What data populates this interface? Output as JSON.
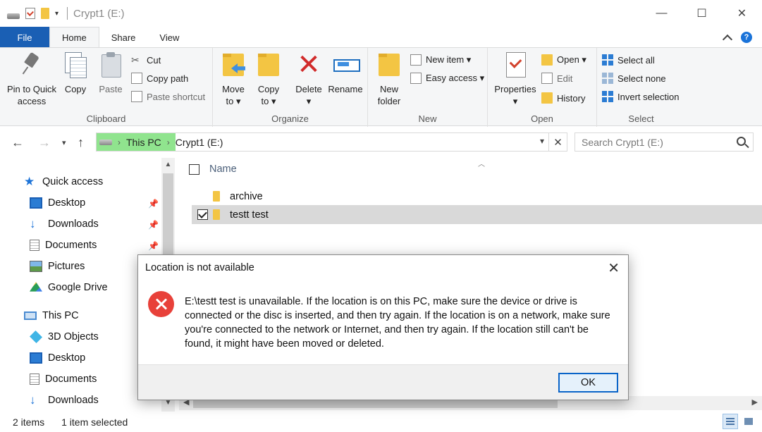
{
  "window": {
    "title": "Crypt1 (E:)",
    "controls": {
      "minimize": "—",
      "maximize": "☐",
      "close": "✕"
    }
  },
  "ribbon_tabs": [
    "File",
    "Home",
    "Share",
    "View"
  ],
  "ribbon": {
    "clipboard": {
      "pin_label_1": "Pin to Quick",
      "pin_label_2": "access",
      "copy": "Copy",
      "paste": "Paste",
      "cut": "Cut",
      "copy_path": "Copy path",
      "paste_shortcut": "Paste shortcut",
      "group": "Clipboard"
    },
    "organize": {
      "move_to_1": "Move",
      "move_to_2": "to ▾",
      "copy_to_1": "Copy",
      "copy_to_2": "to ▾",
      "delete_1": "Delete",
      "delete_2": "▾",
      "rename": "Rename",
      "group": "Organize"
    },
    "new": {
      "new_folder_1": "New",
      "new_folder_2": "folder",
      "new_item": "New item ▾",
      "easy_access": "Easy access ▾",
      "group": "New"
    },
    "open": {
      "properties_1": "Properties",
      "properties_2": "▾",
      "open": "Open ▾",
      "edit": "Edit",
      "history": "History",
      "group": "Open"
    },
    "select": {
      "select_all": "Select all",
      "select_none": "Select none",
      "invert_selection": "Invert selection",
      "group": "Select"
    }
  },
  "address_bar": {
    "segments": [
      "This PC",
      "Crypt1 (E:)"
    ],
    "search_placeholder": "Search Crypt1 (E:)"
  },
  "nav_pane": {
    "quick_access": "Quick access",
    "quick_items": [
      "Desktop",
      "Downloads",
      "Documents",
      "Pictures",
      "Google Drive"
    ],
    "this_pc": "This PC",
    "pc_items": [
      "3D Objects",
      "Desktop",
      "Documents",
      "Downloads"
    ]
  },
  "file_list": {
    "column_name": "Name",
    "rows": [
      {
        "name": "archive",
        "selected": false
      },
      {
        "name": "testt test",
        "selected": true
      }
    ]
  },
  "status_bar": {
    "item_count": "2 items",
    "selection": "1 item selected"
  },
  "dialog": {
    "title": "Location is not available",
    "message": "E:\\testt test is unavailable. If the location is on this PC, make sure the device or drive is connected or the disc is inserted, and then try again. If the location is on a network, make sure you're connected to the network or Internet, and then try again. If the location still can't be found, it might have been moved or deleted.",
    "ok": "OK"
  },
  "colors": {
    "file_tab": "#1a5fb4",
    "address_highlight": "#90e48e",
    "error_icon": "#e8413a",
    "selection_row": "#d9d9d9"
  }
}
